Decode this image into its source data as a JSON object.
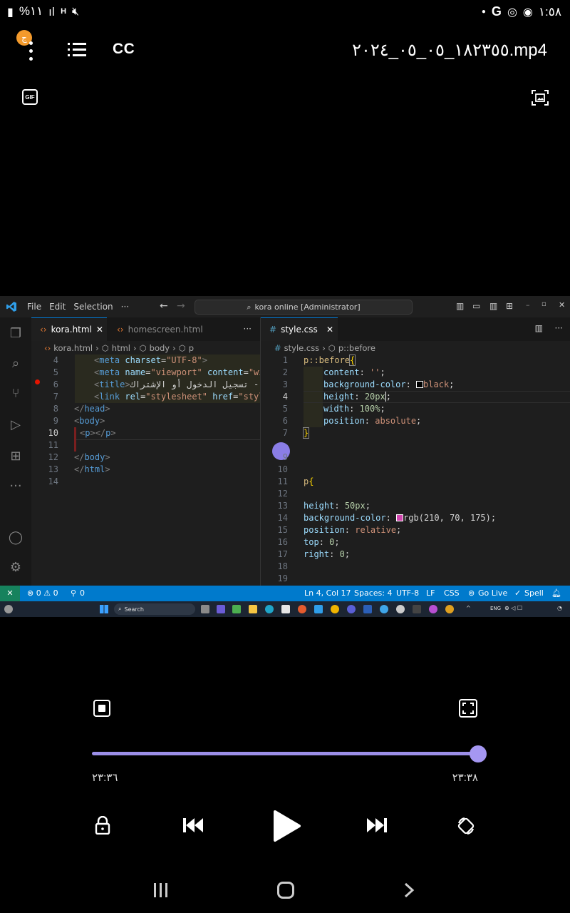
{
  "status_bar": {
    "battery": "%١١",
    "network": "H",
    "time": "١:٥٨"
  },
  "player": {
    "notification_badge": "ج",
    "cc_label": "CC",
    "file_title": "١٨٢٣٥٥_٠٥_٠٥_٢٠٢٤.mp4",
    "gif_label": "GIF",
    "time_elapsed": "٢٣:٣٦",
    "time_total": "٢٣:٣٨",
    "progress": 1.0
  },
  "vscode": {
    "menu": [
      "File",
      "Edit",
      "Selection",
      "···"
    ],
    "search": "kora online [Administrator]",
    "tabs_left": [
      {
        "label": "kora.html",
        "active": true
      },
      {
        "label": "homescreen.html",
        "active": false
      }
    ],
    "tab_right": "style.css",
    "breadcrumb_left": [
      "kora.html",
      "html",
      "body",
      "p"
    ],
    "breadcrumb_right": [
      "style.css",
      "p::before"
    ],
    "html_line_numbers": [
      "4",
      "5",
      "6",
      "7",
      "8",
      "9",
      "10",
      "11",
      "12",
      "13",
      "14"
    ],
    "html_lines": [
      {
        "n": "4",
        "t": "<meta charset=\"UTF-8\">"
      },
      {
        "n": "5",
        "t": "<meta name=\"viewport\" content=\"wid"
      },
      {
        "n": "6",
        "t": "<title>تسجيل الدخول أو الإشتراك -"
      },
      {
        "n": "7",
        "t": "<link rel=\"stylesheet\" href=\"style"
      },
      {
        "n": "8",
        "t": "</head>"
      },
      {
        "n": "9",
        "t": "<body>"
      },
      {
        "n": "10",
        "t": "<p></p>"
      },
      {
        "n": "11",
        "t": ""
      },
      {
        "n": "12",
        "t": "</body>"
      },
      {
        "n": "13",
        "t": "</html>"
      },
      {
        "n": "14",
        "t": ""
      }
    ],
    "css_line_numbers": [
      "1",
      "2",
      "3",
      "4",
      "5",
      "6",
      "7",
      "9",
      "10",
      "11",
      "12",
      "13",
      "14",
      "15",
      "16",
      "17",
      "18",
      "19"
    ],
    "css": {
      "sel1": "p::before",
      "l2_prop": "content",
      "l2_val": "''",
      "l3_prop": "background-color",
      "l3_val": "black",
      "l4_prop": "height",
      "l4_val": "20px",
      "l5_prop": "width",
      "l5_val": "100%",
      "l6_prop": "position",
      "l6_val": "absolute",
      "sel2": "p",
      "l13_prop": "height",
      "l13_val": "50px",
      "l14_prop": "background-color",
      "l14_val": "rgb(210, 70, 175)",
      "l15_prop": "position",
      "l15_val": "relative",
      "l16_prop": "top",
      "l16_val": "0",
      "l17_prop": "right",
      "l17_val": "0"
    },
    "statusbar": {
      "problems": "⊗ 0 ⚠ 0",
      "ports": "0",
      "position": "Ln 4, Col 17",
      "spaces": "Spaces: 4",
      "encoding": "UTF-8",
      "eol": "LF",
      "language": "CSS",
      "golive": "Go Live",
      "spell": "Spell"
    },
    "taskbar_search": "Search",
    "taskbar_lang": "ENG"
  },
  "colors": {
    "accent": "#a597f2",
    "vscode_blue": "#007acc",
    "swatch_pink": "#d246af"
  }
}
